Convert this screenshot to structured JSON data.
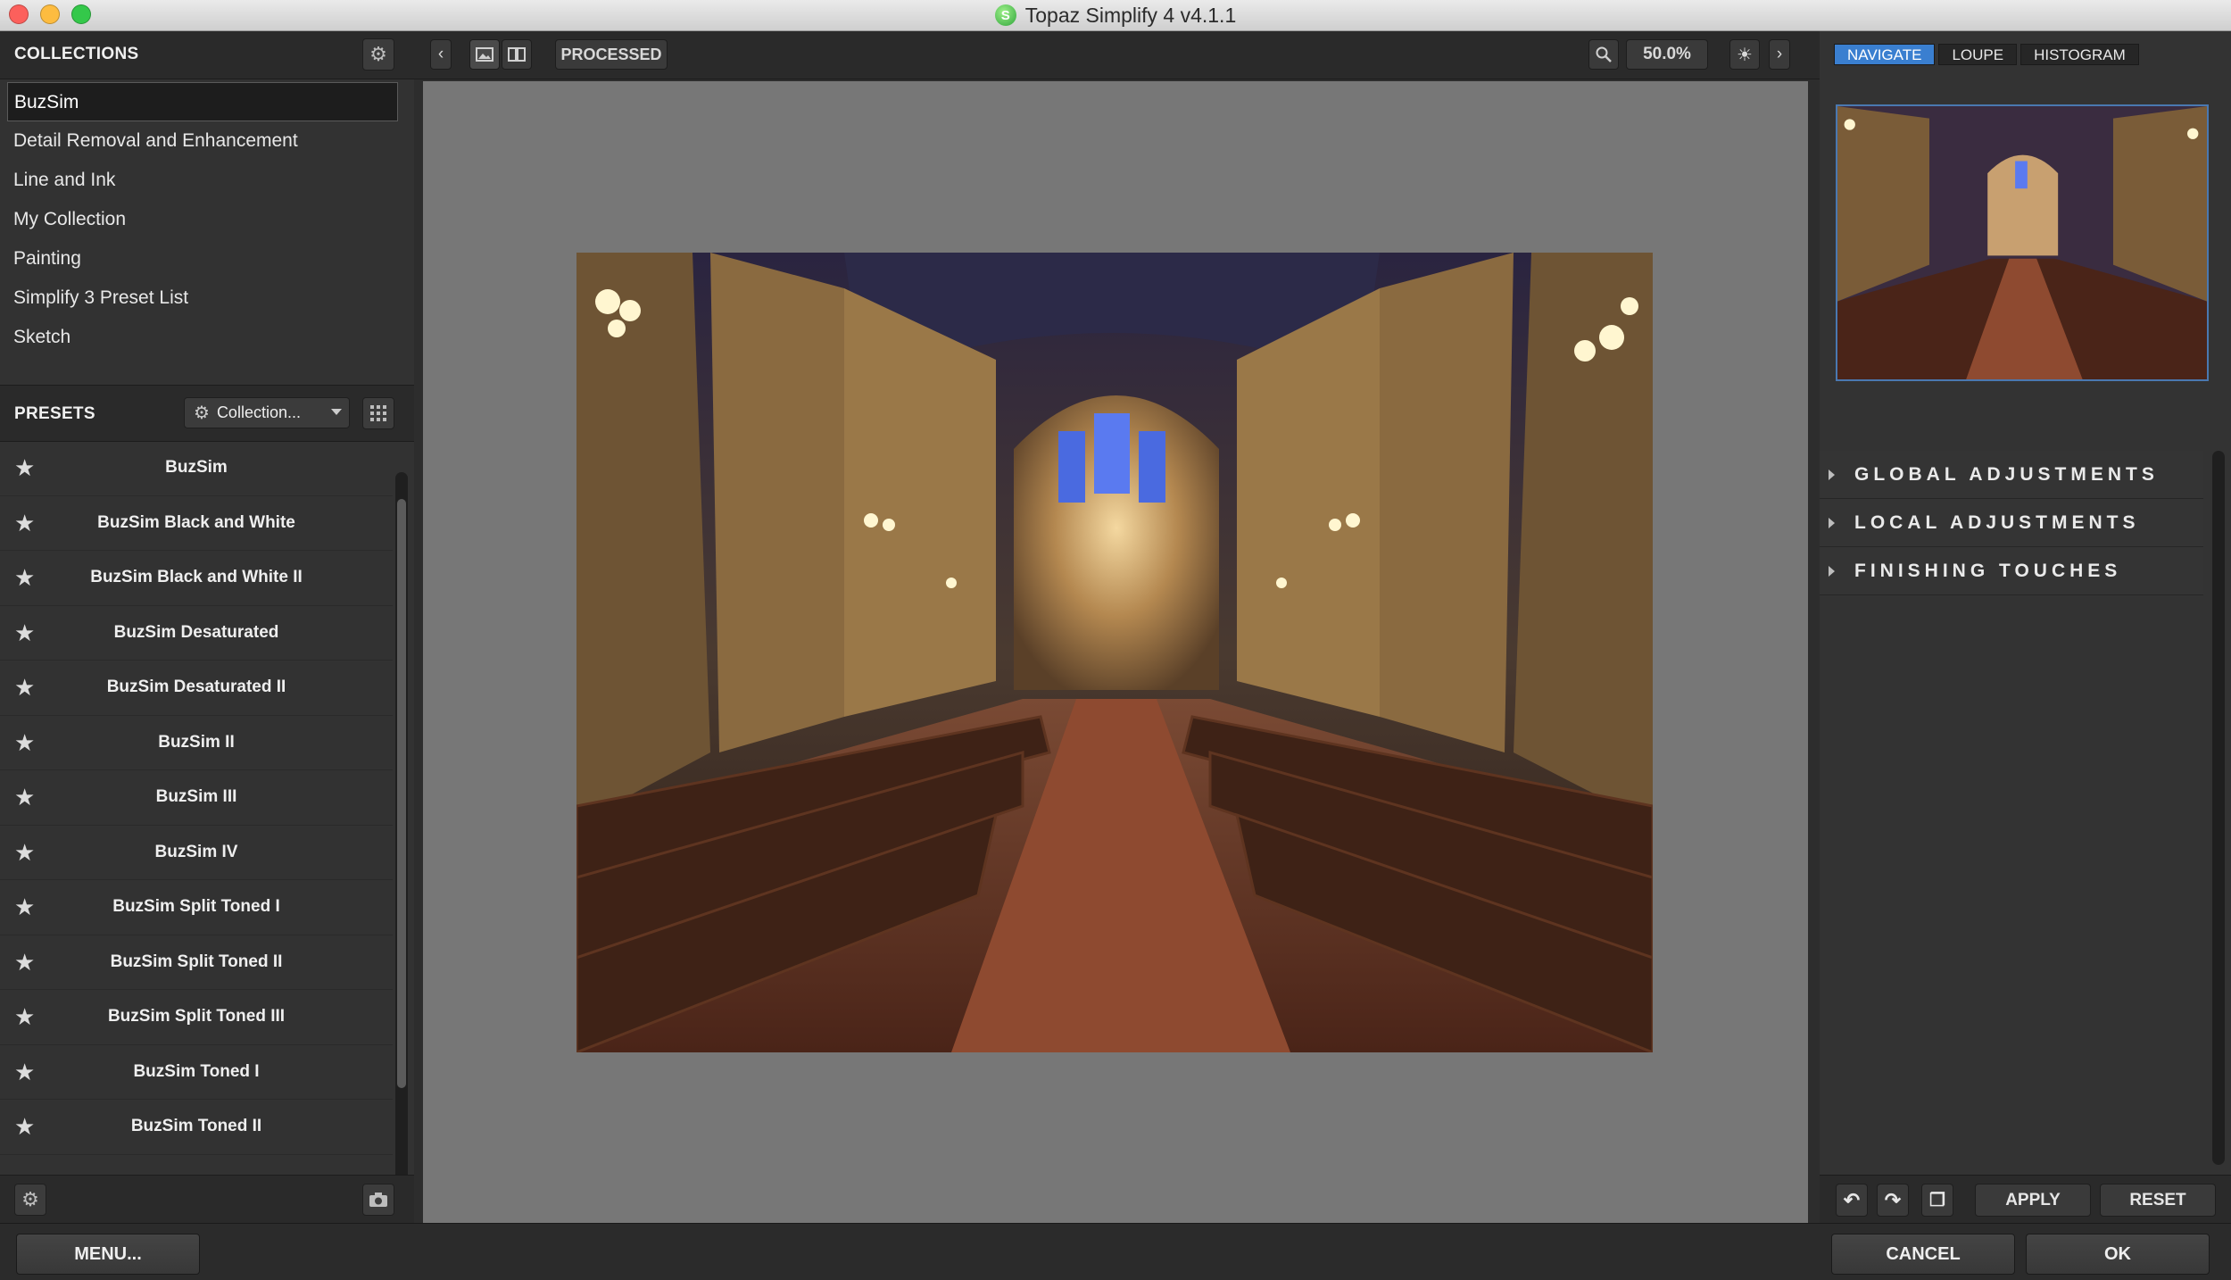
{
  "window": {
    "title": "Topaz Simplify 4 v4.1.1",
    "app_icon_glyph": "S"
  },
  "collections": {
    "header": "COLLECTIONS",
    "items": [
      "BuzSim",
      "Detail Removal and Enhancement",
      "Line and Ink",
      "My Collection",
      "Painting",
      "Simplify 3 Preset List",
      "Sketch"
    ],
    "selected": "BuzSim"
  },
  "presets": {
    "header": "PRESETS",
    "dropdown_label": "Collection...",
    "items": [
      "BuzSim",
      "BuzSim Black and White",
      "BuzSim Black and White II",
      "BuzSim Desaturated",
      "BuzSim Desaturated II",
      "BuzSim II",
      "BuzSim III",
      "BuzSim IV",
      "BuzSim Split Toned I",
      "BuzSim Split Toned II",
      "BuzSim Split Toned III",
      "BuzSim Toned I",
      "BuzSim Toned II"
    ]
  },
  "toolbar": {
    "view_mode": "PROCESSED",
    "zoom": "50.0%"
  },
  "navigator": {
    "tabs": [
      "NAVIGATE",
      "LOUPE",
      "HISTOGRAM"
    ],
    "active_tab": "NAVIGATE"
  },
  "adjustments": [
    "GLOBAL ADJUSTMENTS",
    "LOCAL ADJUSTMENTS",
    "FINISHING TOUCHES"
  ],
  "actions": {
    "apply": "APPLY",
    "reset": "RESET"
  },
  "bottom": {
    "menu": "MENU...",
    "cancel": "CANCEL",
    "ok": "OK"
  },
  "colors": {
    "accent": "#3a7fd0",
    "panel": "#333333",
    "canvas": "#777777"
  }
}
